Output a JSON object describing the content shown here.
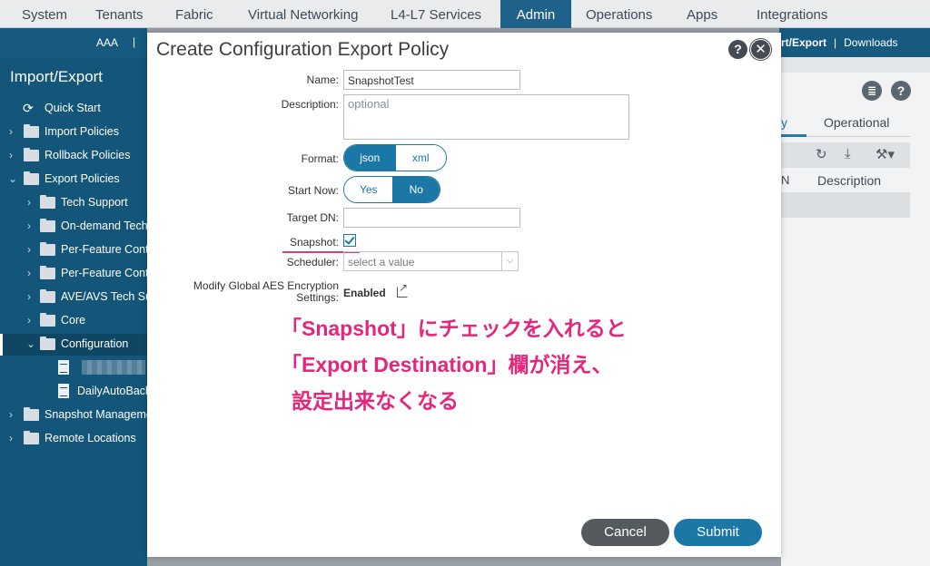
{
  "topnav": {
    "tabs": [
      {
        "label": "System"
      },
      {
        "label": "Tenants"
      },
      {
        "label": "Fabric"
      },
      {
        "label": "Virtual Networking"
      },
      {
        "label": "L4-L7 Services"
      },
      {
        "label": "Admin",
        "active": true
      },
      {
        "label": "Operations"
      },
      {
        "label": "Apps"
      },
      {
        "label": "Integrations"
      }
    ]
  },
  "subnav": {
    "aaa": "AAA",
    "separator": "|",
    "crumb_active": "rt/Export",
    "crumb_sep": "|",
    "downloads": "Downloads"
  },
  "sidebar": {
    "title": "Import/Export",
    "items": [
      {
        "label": "Quick Start"
      },
      {
        "label": "Import Policies"
      },
      {
        "label": "Rollback Policies"
      },
      {
        "label": "Export Policies"
      },
      {
        "label": "Tech Support"
      },
      {
        "label": "On-demand Tech"
      },
      {
        "label": "Per-Feature Cont"
      },
      {
        "label": "Per-Feature Cont"
      },
      {
        "label": "AVE/AVS Tech Su"
      },
      {
        "label": "Core"
      },
      {
        "label": "Configuration"
      },
      {
        "label": ""
      },
      {
        "label": "DailyAutoBack"
      },
      {
        "label": "Snapshot Manageme"
      },
      {
        "label": "Remote Locations"
      }
    ]
  },
  "background_panel": {
    "tab_partial": "y",
    "tab_operational": "Operational",
    "col_partial": "N",
    "col_description": "Description",
    "icons": [
      "list-icon",
      "help-icon",
      "refresh-icon",
      "download-icon",
      "tools-icon"
    ]
  },
  "modal": {
    "title": "Create Configuration Export Policy",
    "fields": {
      "name_label": "Name:",
      "name_value": "SnapshotTest",
      "description_label": "Description:",
      "description_placeholder": "optional",
      "format_label": "Format:",
      "format_json": "json",
      "format_xml": "xml",
      "format_selected": "json",
      "startnow_label": "Start Now:",
      "startnow_yes": "Yes",
      "startnow_no": "No",
      "startnow_selected": "No",
      "targetdn_label": "Target DN:",
      "targetdn_value": "",
      "snapshot_label": "Snapshot:",
      "snapshot_checked": true,
      "scheduler_label": "Scheduler:",
      "scheduler_placeholder": "select a value",
      "aes_label_line1": "Modify Global AES Encryption",
      "aes_label_line2": "Settings:",
      "aes_value": "Enabled"
    },
    "annotation": {
      "line1": "「Snapshot」にチェックを入れると",
      "line2": "「Export Destination」欄が消え、",
      "line3": "設定出来なくなる"
    },
    "cancel_label": "Cancel",
    "submit_label": "Submit",
    "help_glyph": "?",
    "close_glyph": "✕"
  },
  "colors": {
    "nav_active": "#1f6289",
    "sidebar": "#135679",
    "accent": "#1b77a6",
    "annotation": "#e5267a",
    "cancel": "#555a5f"
  }
}
